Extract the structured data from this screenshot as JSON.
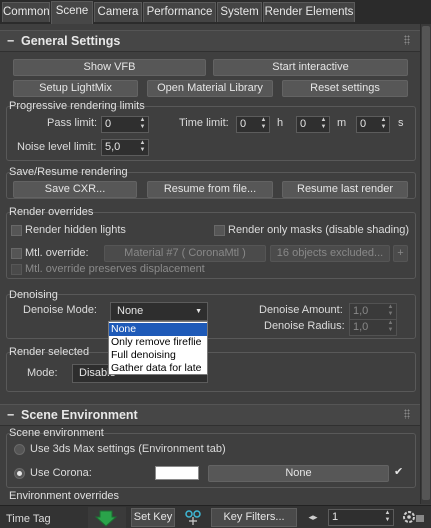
{
  "tabs": [
    {
      "label": "Common"
    },
    {
      "label": "Scene"
    },
    {
      "label": "Camera"
    },
    {
      "label": "Performance"
    },
    {
      "label": "System"
    },
    {
      "label": "Render Elements"
    }
  ],
  "active_tab": "Scene",
  "general_settings": {
    "title": "General Settings",
    "collapse_glyph": "−",
    "show_vfb": "Show VFB",
    "start_interactive": "Start interactive",
    "setup_lightmix": "Setup LightMix",
    "open_material_library": "Open Material Library",
    "reset_settings": "Reset settings"
  },
  "progressive": {
    "title": "Progressive rendering limits",
    "pass_limit_label": "Pass limit:",
    "pass_limit_value": "0",
    "time_limit_label": "Time limit:",
    "hours": "0",
    "h_label": "h",
    "minutes": "0",
    "m_label": "m",
    "seconds": "0",
    "s_label": "s",
    "noise_label": "Noise level limit:",
    "noise_value": "5,0"
  },
  "save_resume": {
    "title": "Save/Resume rendering",
    "save_cxr": "Save CXR...",
    "resume_from_file": "Resume from file...",
    "resume_last": "Resume last render"
  },
  "overrides": {
    "title": "Render overrides",
    "hidden_lights": "Render hidden lights",
    "only_masks": "Render only masks (disable shading)",
    "mtl_override_label": "Mtl. override:",
    "material": "Material #7  ( CoronaMtl )",
    "excluded": "16 objects excluded...",
    "plus": "+",
    "preserves_displacement": "Mtl. override preserves displacement"
  },
  "denoising": {
    "title": "Denoising",
    "mode_label": "Denoise Mode:",
    "mode_value": "None",
    "amount_label": "Denoise Amount:",
    "amount_value": "1,0",
    "radius_label": "Denoise Radius:",
    "radius_value": "1,0",
    "options": [
      "None",
      "Only remove fireflie",
      "Full denoising",
      "Gather data for late"
    ],
    "selected_option": "None"
  },
  "render_selected": {
    "title": "Render selected",
    "mode_label": "Mode:",
    "mode_value": "Disable"
  },
  "scene_environment": {
    "title": "Scene Environment",
    "collapse_glyph": "−",
    "group_title": "Scene environment",
    "use_3dsmax": "Use 3ds Max settings (Environment tab)",
    "use_corona": "Use Corona:",
    "swatch_color": "#ffffff",
    "map_button": "None",
    "env_overrides_title": "Environment overrides"
  },
  "bottom_bar": {
    "time_tag": "Time Tag",
    "set_key": "Set Key",
    "key_filters": "Key Filters...",
    "frame": "1"
  }
}
